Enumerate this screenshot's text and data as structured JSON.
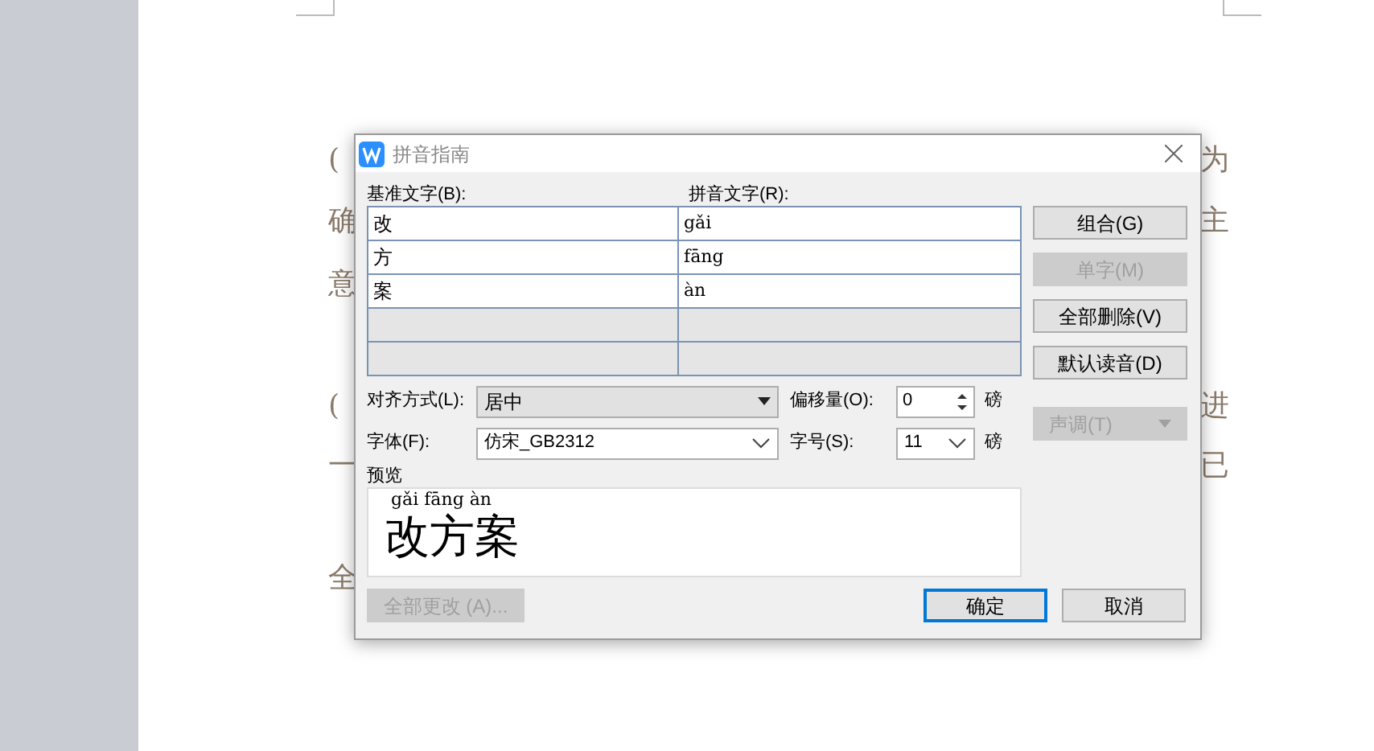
{
  "document": {
    "lines": [
      {
        "left": "(",
        "right": "为"
      },
      {
        "left": "确",
        "right": "主"
      },
      {
        "left": "意"
      },
      {
        "left": "(",
        "right": "进"
      },
      {
        "left": "一",
        "right": "已"
      },
      {
        "left": "全"
      }
    ]
  },
  "dialog": {
    "title": "拼音指南",
    "base_label": "基准文字(B):",
    "ruby_label": "拼音文字(R):",
    "rows": [
      {
        "base": "改",
        "ruby": "gǎi"
      },
      {
        "base": "方",
        "ruby": "fāng"
      },
      {
        "base": "案",
        "ruby": "àn"
      }
    ],
    "side_buttons": [
      {
        "label": "组合(G)",
        "disabled": false
      },
      {
        "label": "单字(M)",
        "disabled": true
      },
      {
        "label": "全部删除(V)",
        "disabled": false
      },
      {
        "label": "默认读音(D)",
        "disabled": false
      }
    ],
    "tone": {
      "label": "声调(T)",
      "disabled": true
    },
    "alignment": {
      "label": "对齐方式(L):",
      "value": "居中"
    },
    "offset": {
      "label": "偏移量(O):",
      "value": "0",
      "unit": "磅"
    },
    "font": {
      "label": "字体(F):",
      "value": "仿宋_GB2312"
    },
    "size": {
      "label": "字号(S):",
      "value": "11",
      "unit": "磅"
    },
    "preview": {
      "label": "预览",
      "ruby": "gǎi fāng àn",
      "text": "改方案"
    },
    "apply_all": {
      "label": "全部更改 (A)...",
      "disabled": true
    },
    "ok": {
      "label": "确定",
      "default": true
    },
    "cancel": {
      "label": "取消",
      "default": false
    }
  }
}
